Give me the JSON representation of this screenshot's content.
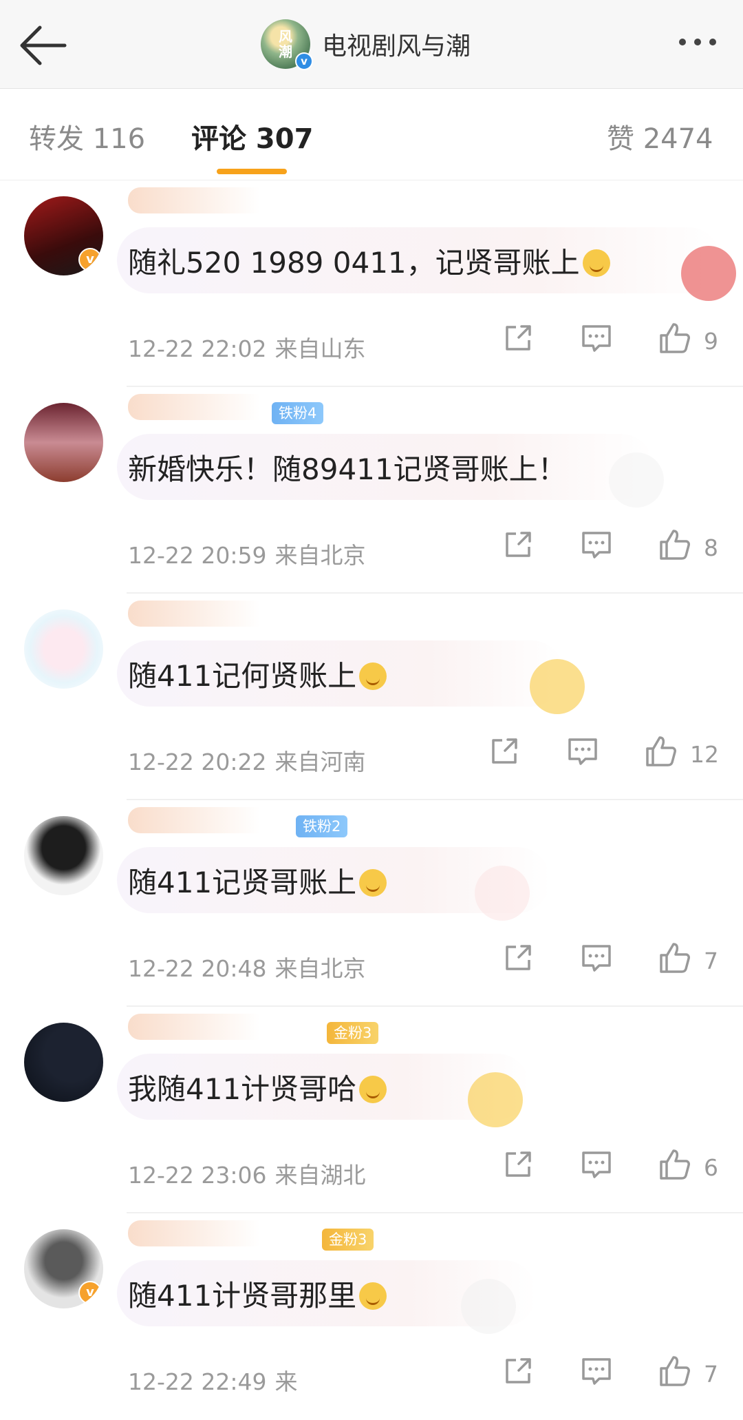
{
  "header": {
    "back_icon": "arrow-left-icon",
    "account_name": "电视剧风与潮",
    "avatar_text": "风潮",
    "verified_mark": "v",
    "more_icon": "more-dots-icon"
  },
  "tabs": [
    {
      "label": "转发 116",
      "active": false
    },
    {
      "label": "评论 307",
      "active": true
    },
    {
      "label": "赞 2474",
      "active": false
    }
  ],
  "colors": {
    "accent": "#f7a21b",
    "fan_badge_blue": "#6fb2f3",
    "fan_badge_gold": "#f4b63b"
  },
  "comments": [
    {
      "text": "随礼520 1989 0411，记贤哥账上",
      "emoji": "star-emoji",
      "time": "12-22 22:02",
      "location": "来自山东",
      "likes": "9",
      "badge": "",
      "verified": "v"
    },
    {
      "text": "新婚快乐！随89411记贤哥账上！",
      "emoji": "",
      "time": "12-22 20:59",
      "location": "来自北京",
      "likes": "8",
      "badge": "铁粉4",
      "verified": ""
    },
    {
      "text": "随411记何贤账上",
      "emoji": "smile-emoji",
      "time": "12-22 20:22",
      "location": "来自河南",
      "likes": "12",
      "badge": "",
      "verified": ""
    },
    {
      "text": "随411记贤哥账上",
      "emoji": "kiss-emoji",
      "time": "12-22 20:48",
      "location": "来自北京",
      "likes": "7",
      "badge": "铁粉2",
      "verified": ""
    },
    {
      "text": "我随411计贤哥哈",
      "emoji": "grin-emoji",
      "time": "12-22 23:06",
      "location": "来自湖北",
      "likes": "6",
      "badge": "金粉3",
      "verified": ""
    },
    {
      "text": "随411计贤哥那里",
      "emoji": "doge-emoji",
      "time": "12-22 22:49",
      "location": "来",
      "likes": "7",
      "badge": "金粉3",
      "verified": "v"
    }
  ],
  "action_icons": {
    "share": "share-icon",
    "comment": "comment-icon",
    "like": "thumbs-up-icon"
  }
}
